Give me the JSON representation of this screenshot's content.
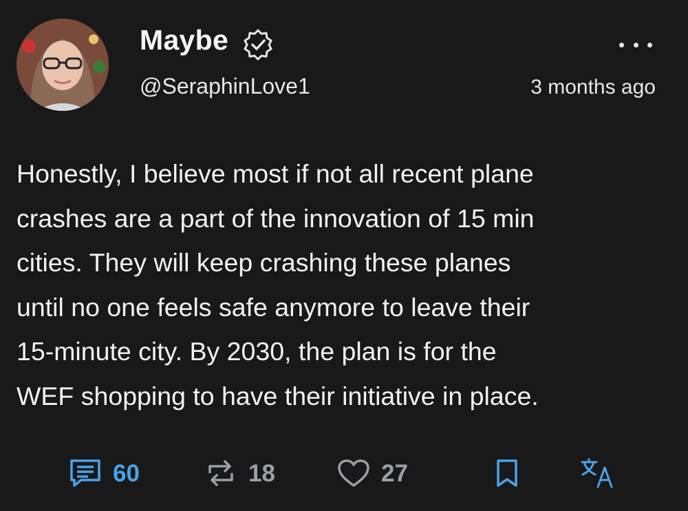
{
  "post": {
    "author_name": "Maybe",
    "handle": "@SeraphinLove1",
    "timestamp": "3 months ago",
    "text": "Honestly, I believe most if not all recent plane\ncrashes are a part of the innovation of 15 min\ncities. They will keep crashing these planes\nuntil no one feels safe anymore to leave their\n15-minute city. By 2030, the plan is for the\nWEF shopping to have their initiative in place."
  },
  "actions": {
    "comments": "60",
    "reposts": "18",
    "likes": "27"
  },
  "icons": {
    "verified": "verified-badge-icon",
    "more": "more-options-icon",
    "comment": "comment-icon",
    "repost": "repost-icon",
    "like": "heart-icon",
    "bookmark": "bookmark-icon",
    "translate": "translate-icon"
  },
  "colors": {
    "background": "#191919",
    "text": "#f3f3f3",
    "accent_blue": "#4aa3ea",
    "muted": "#9aa0a6"
  }
}
